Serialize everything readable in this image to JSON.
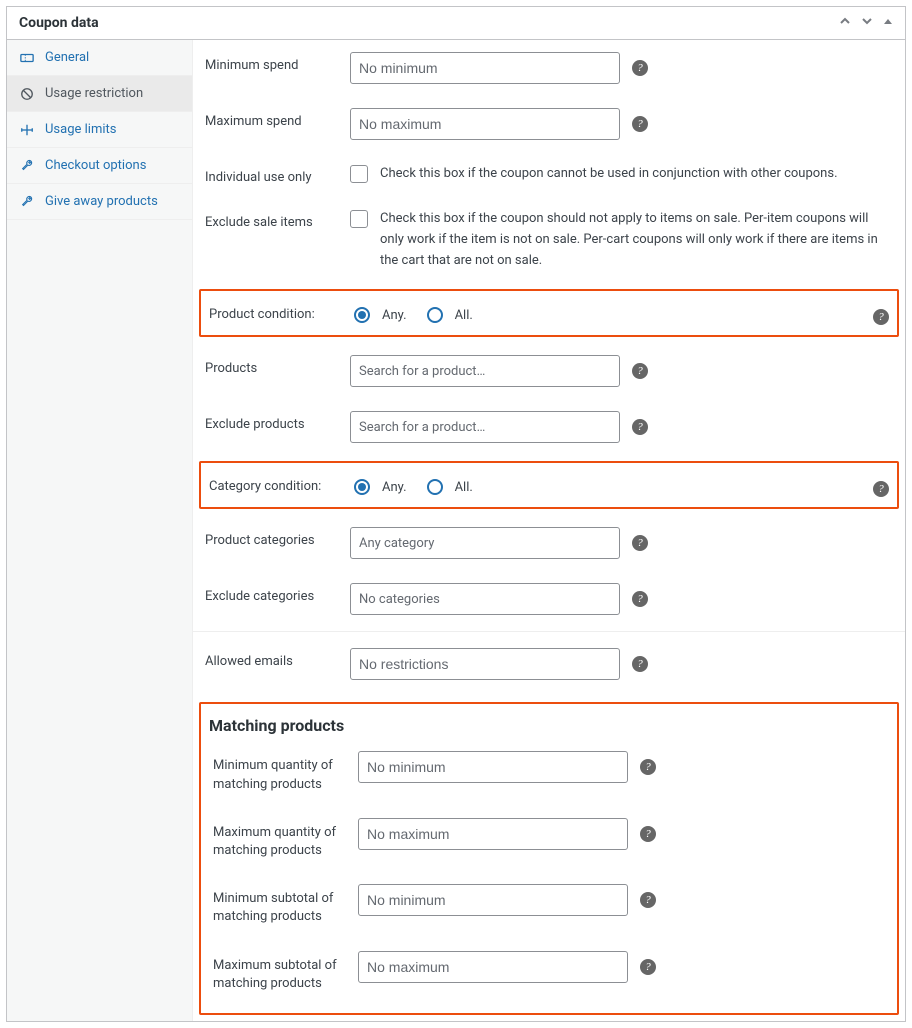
{
  "header": {
    "title": "Coupon data"
  },
  "sidebar": {
    "items": [
      {
        "label": "General"
      },
      {
        "label": "Usage restriction"
      },
      {
        "label": "Usage limits"
      },
      {
        "label": "Checkout options"
      },
      {
        "label": "Give away products"
      }
    ]
  },
  "fields": {
    "min_spend": {
      "label": "Minimum spend",
      "placeholder": "No minimum"
    },
    "max_spend": {
      "label": "Maximum spend",
      "placeholder": "No maximum"
    },
    "individual": {
      "label": "Individual use only",
      "text": "Check this box if the coupon cannot be used in conjunction with other coupons."
    },
    "exclude_sale": {
      "label": "Exclude sale items",
      "text": "Check this box if the coupon should not apply to items on sale. Per-item coupons will only work if the item is not on sale. Per-cart coupons will only work if there are items in the cart that are not on sale."
    },
    "product_condition": {
      "label": "Product condition:",
      "any": "Any.",
      "all": "All."
    },
    "products": {
      "label": "Products",
      "placeholder": "Search for a product…"
    },
    "exclude_products": {
      "label": "Exclude products",
      "placeholder": "Search for a product…"
    },
    "category_condition": {
      "label": "Category condition:",
      "any": "Any.",
      "all": "All."
    },
    "categories": {
      "label": "Product categories",
      "placeholder": "Any category"
    },
    "exclude_categories": {
      "label": "Exclude categories",
      "placeholder": "No categories"
    },
    "emails": {
      "label": "Allowed emails",
      "placeholder": "No restrictions"
    }
  },
  "matching": {
    "title": "Matching products",
    "min_qty": {
      "label": "Minimum quantity of matching products",
      "placeholder": "No minimum"
    },
    "max_qty": {
      "label": "Maximum quantity of matching products",
      "placeholder": "No maximum"
    },
    "min_sub": {
      "label": "Minimum subtotal of matching products",
      "placeholder": "No minimum"
    },
    "max_sub": {
      "label": "Maximum subtotal of matching products",
      "placeholder": "No maximum"
    }
  }
}
